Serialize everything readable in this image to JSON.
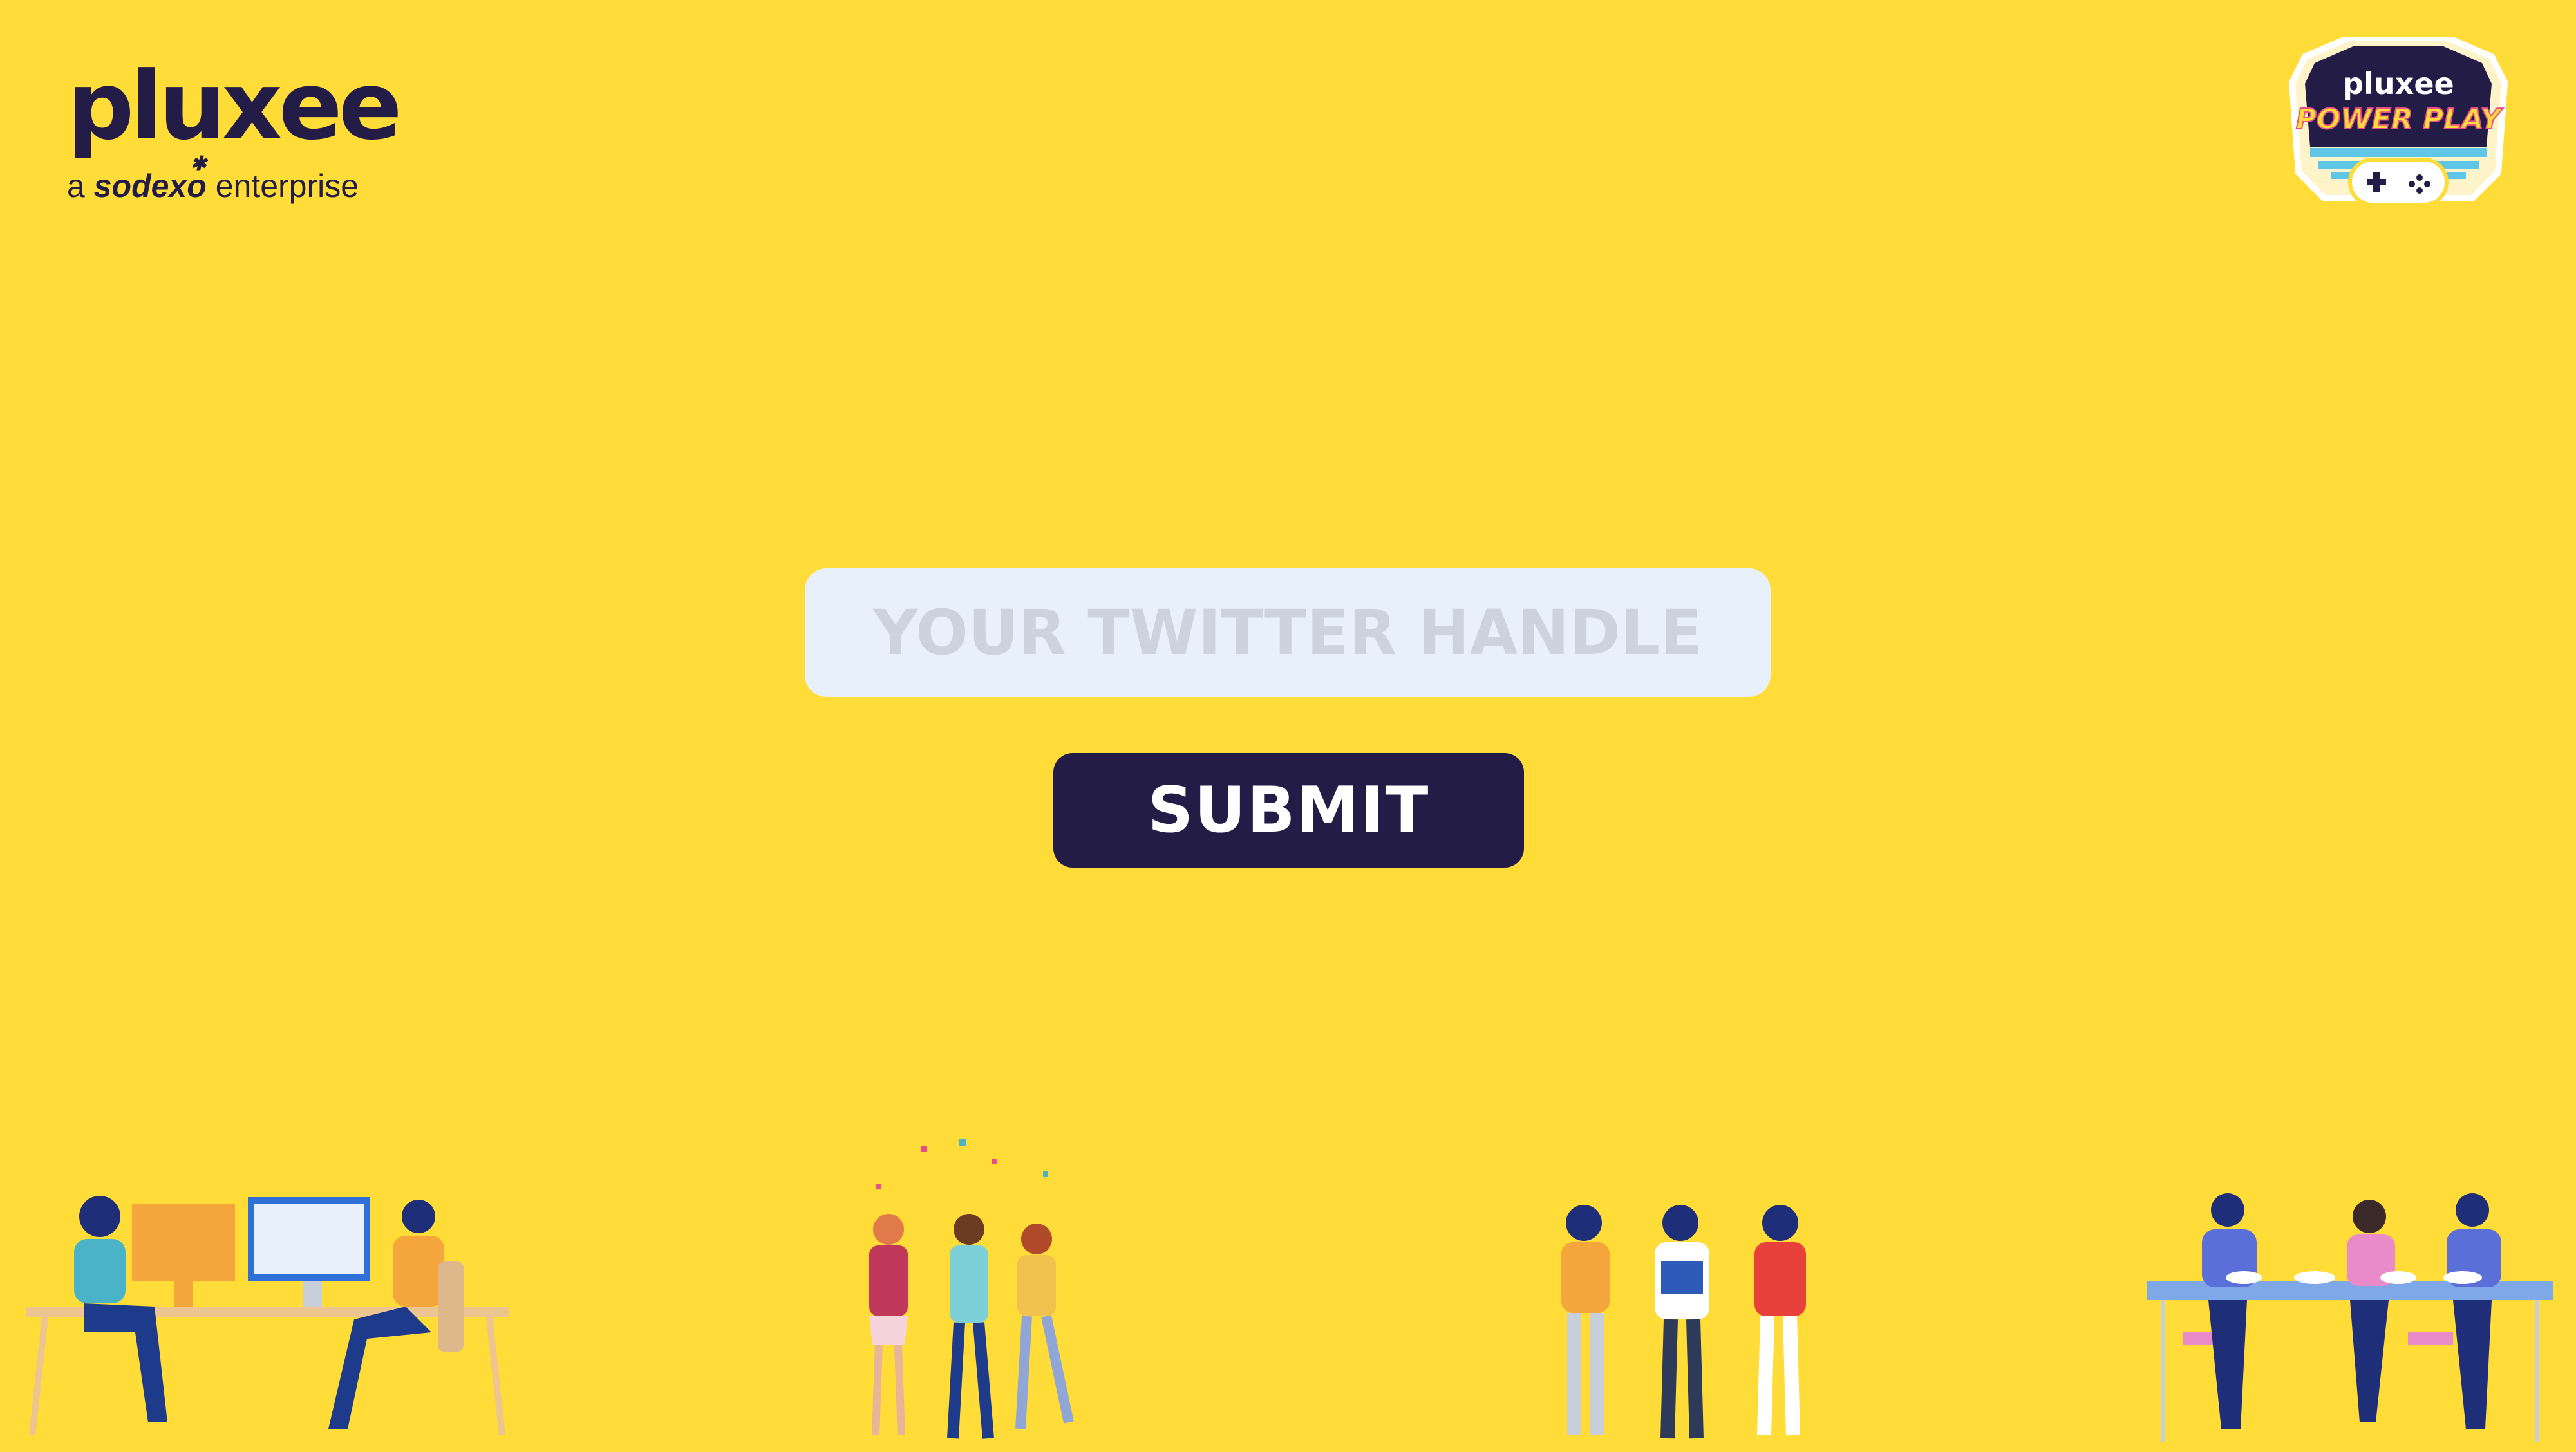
{
  "logo": {
    "wordmark": "pluxee",
    "tagline_prefix": "a",
    "tagline_brand": "sodexo",
    "tagline_suffix": "enterprise"
  },
  "badge": {
    "brand": "pluxee",
    "title": "POWER PLAY"
  },
  "form": {
    "handle_placeholder": "YOUR TWITTER HANDLE",
    "handle_value": "",
    "submit_label": "SUBMIT"
  },
  "colors": {
    "background": "#FFDC37",
    "navy": "#221C46",
    "input_bg": "#E8F1FB",
    "placeholder": "#CDD3DE"
  }
}
